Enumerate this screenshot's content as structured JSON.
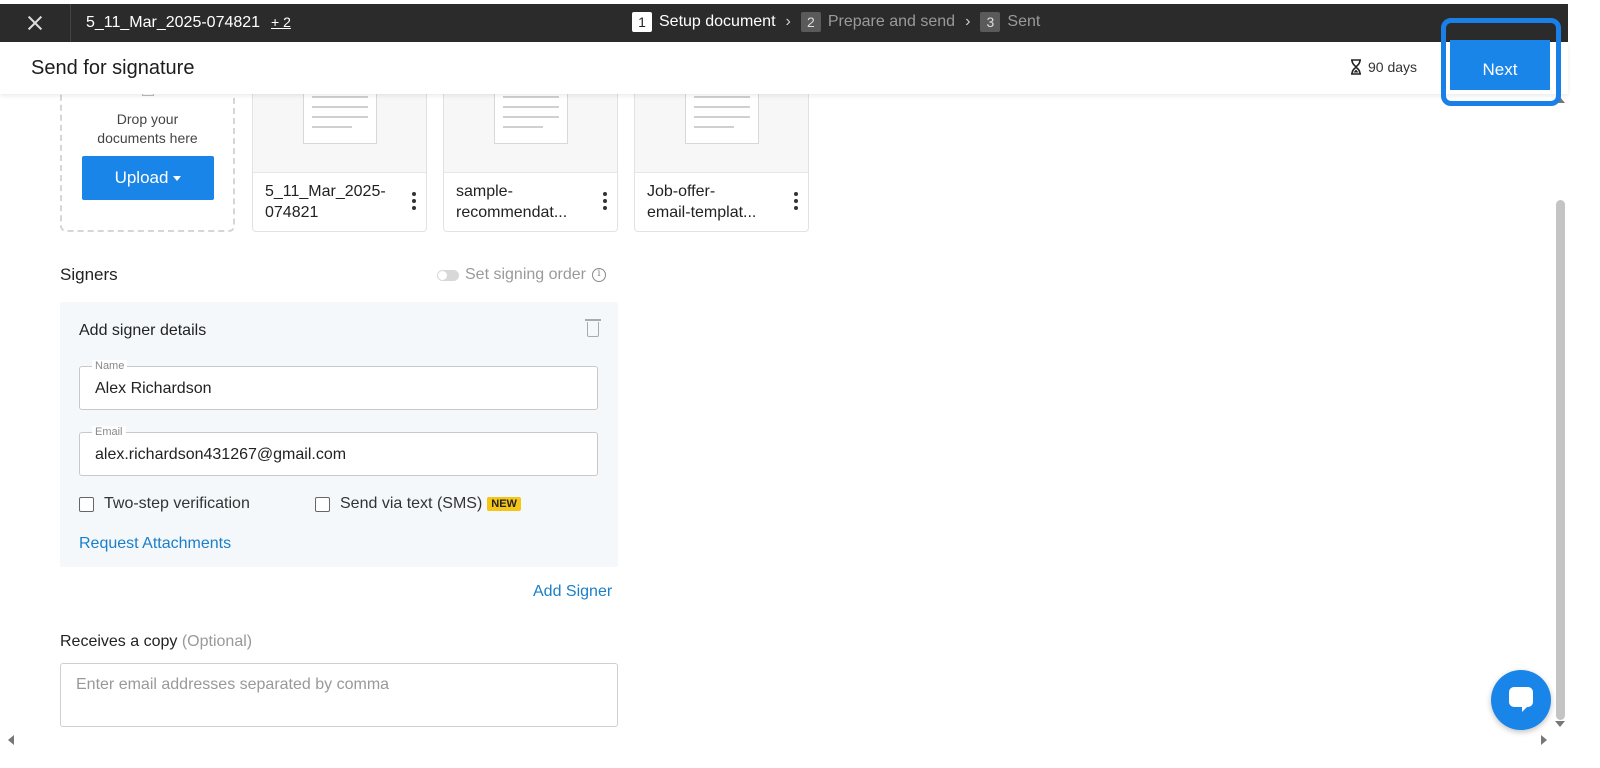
{
  "topbar": {
    "document_name": "5_11_Mar_2025-074821",
    "more_docs": "+ 2",
    "steps": [
      {
        "num": "1",
        "label": "Setup document"
      },
      {
        "num": "2",
        "label": "Prepare and send"
      },
      {
        "num": "3",
        "label": "Sent"
      }
    ],
    "step_separator": "›"
  },
  "header": {
    "title": "Send for signature",
    "expiry": "90 days",
    "next_label": "Next"
  },
  "upload": {
    "drop_text_line1": "Drop your",
    "drop_text_line2": "documents here",
    "upload_label": "Upload"
  },
  "documents": [
    {
      "title": "5_11_Mar_2025-\n074821"
    },
    {
      "title": "sample-\nrecommendat..."
    },
    {
      "title": "Job-offer-\nemail-templat..."
    }
  ],
  "signers": {
    "heading": "Signers",
    "signing_order_label": "Set signing order",
    "card_title": "Add signer details",
    "name_label": "Name",
    "name_value": "Alex Richardson",
    "email_label": "Email",
    "email_value": "alex.richardson431267@gmail.com",
    "two_step_label": "Two-step verification",
    "sms_label": "Send via text (SMS)",
    "new_badge": "NEW",
    "request_attachments": "Request Attachments",
    "add_signer": "Add Signer"
  },
  "copy": {
    "heading": "Receives a copy",
    "optional": "(Optional)",
    "placeholder": "Enter email addresses separated by comma"
  },
  "colors": {
    "primary": "#1a85e8",
    "topbar": "#2b2b2b",
    "badge": "#f5c518",
    "link": "#1a7fc8"
  }
}
